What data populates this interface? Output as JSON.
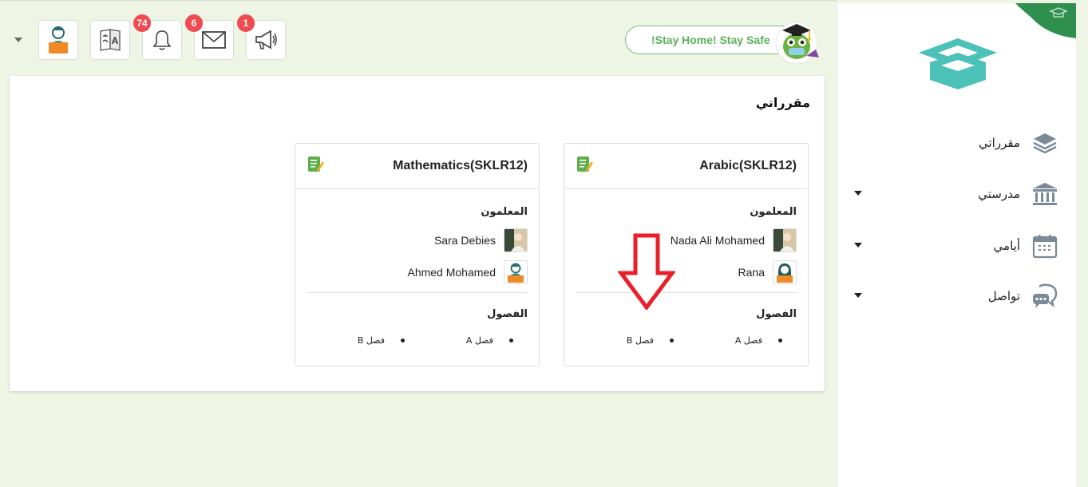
{
  "topbar": {
    "banner_text": "!Stay Home! Stay Safe",
    "badges": {
      "notifications": "74",
      "messages": "6",
      "announcements": "1"
    }
  },
  "sidebar": {
    "items": [
      {
        "label": "مقرراتي",
        "icon": "layers-icon",
        "has_dropdown": false
      },
      {
        "label": "مدرستي",
        "icon": "school-building-icon",
        "has_dropdown": true
      },
      {
        "label": "أيامي",
        "icon": "calendar-icon",
        "has_dropdown": true
      },
      {
        "label": "تواصل",
        "icon": "chat-bubbles-icon",
        "has_dropdown": true
      }
    ]
  },
  "main": {
    "title": "مقرراتي",
    "courses": [
      {
        "title": "Arabic(SKLR12)",
        "teachers_label": "المعلمون",
        "teachers": [
          {
            "name": "Nada Ali Mohamed",
            "avatar": "photo-avatar"
          },
          {
            "name": "Rana",
            "avatar": "female-teacher-avatar"
          }
        ],
        "classes_label": "الفصول",
        "classes": [
          "فصل A",
          "فصل B"
        ]
      },
      {
        "title": "Mathematics(SKLR12)",
        "teachers_label": "المعلمون",
        "teachers": [
          {
            "name": "Sara Debies",
            "avatar": "photo-avatar"
          },
          {
            "name": "Ahmed Mohamed",
            "avatar": "male-teacher-avatar"
          }
        ],
        "classes_label": "الفصول",
        "classes": [
          "فصل A",
          "فصل B"
        ]
      }
    ]
  },
  "colors": {
    "background": "#eef5e4",
    "accent_green": "#5ab05a",
    "badge_red": "#ef4a4f",
    "annotation_arrow": "#e8202a",
    "logo_teal": "#4cc1b7"
  }
}
